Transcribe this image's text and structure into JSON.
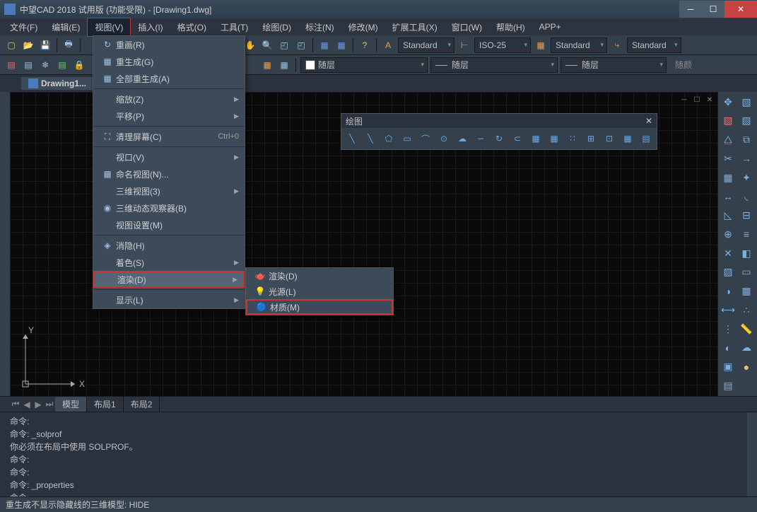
{
  "title": "中望CAD 2018 试用版 (功能受限) - [Drawing1.dwg]",
  "menubar": {
    "items": [
      {
        "label": "文件(F)"
      },
      {
        "label": "编辑(E)"
      },
      {
        "label": "视图(V)",
        "active": true
      },
      {
        "label": "插入(I)"
      },
      {
        "label": "格式(O)"
      },
      {
        "label": "工具(T)"
      },
      {
        "label": "绘图(D)"
      },
      {
        "label": "标注(N)"
      },
      {
        "label": "修改(M)"
      },
      {
        "label": "扩展工具(X)"
      },
      {
        "label": "窗口(W)"
      },
      {
        "label": "帮助(H)"
      },
      {
        "label": "APP+"
      }
    ]
  },
  "toolbar": {
    "styles": {
      "s1": "Standard",
      "s2": "ISO-25",
      "s3": "Standard",
      "s4": "Standard"
    },
    "layers": {
      "l1": "随层",
      "l2": "随层",
      "l3": "随层",
      "l4": "随颜"
    }
  },
  "doc_tab": "Drawing1...",
  "view_menu": {
    "items": [
      {
        "label": "重画(R)",
        "icon": "↻"
      },
      {
        "label": "重生成(G)",
        "icon": "▦"
      },
      {
        "label": "全部重生成(A)",
        "icon": "▦"
      },
      {
        "sep": true
      },
      {
        "label": "缩放(Z)",
        "arrow": true
      },
      {
        "label": "平移(P)",
        "arrow": true
      },
      {
        "sep": true
      },
      {
        "label": "清理屏幕(C)",
        "icon": "⛶",
        "shortcut": "Ctrl+0"
      },
      {
        "sep": true
      },
      {
        "label": "视口(V)",
        "arrow": true
      },
      {
        "label": "命名视图(N)...",
        "icon": "▦"
      },
      {
        "label": "三维视图(3)",
        "arrow": true
      },
      {
        "label": "三维动态观察器(B)",
        "icon": "◉"
      },
      {
        "label": "视图设置(M)"
      },
      {
        "sep": true
      },
      {
        "label": "消隐(H)",
        "icon": "◈"
      },
      {
        "label": "着色(S)",
        "arrow": true
      },
      {
        "label": "渲染(D)",
        "arrow": true,
        "highlighted": true
      },
      {
        "sep": true
      },
      {
        "label": "显示(L)",
        "arrow": true
      }
    ]
  },
  "render_submenu": {
    "items": [
      {
        "label": "渲染(D)",
        "icon": "🫖"
      },
      {
        "label": "光源(L)",
        "icon": "💡"
      },
      {
        "label": "材质(M)",
        "icon": "🔵",
        "highlighted": true
      }
    ]
  },
  "float_toolbar": {
    "title": "绘图",
    "icons": [
      "╲",
      "╲",
      "⬠",
      "▭",
      "⌒",
      "⊙",
      "☁",
      "∽",
      "↻",
      "⊂",
      "▦",
      "▦",
      "∷",
      "⊞",
      "⊡",
      "▦",
      "▤"
    ]
  },
  "layout_tabs": {
    "tabs": [
      "模型",
      "布局1",
      "布局2"
    ],
    "active": 0
  },
  "command": {
    "lines": [
      "命令:",
      "命令: _solprof",
      "你必须在布局中使用 SOLPROF。",
      "命令:",
      "命令:",
      "命令: _properties",
      "命令:"
    ]
  },
  "status": "重生成不显示隐藏线的三维模型: HIDE",
  "axes": {
    "x": "X",
    "y": "Y"
  }
}
